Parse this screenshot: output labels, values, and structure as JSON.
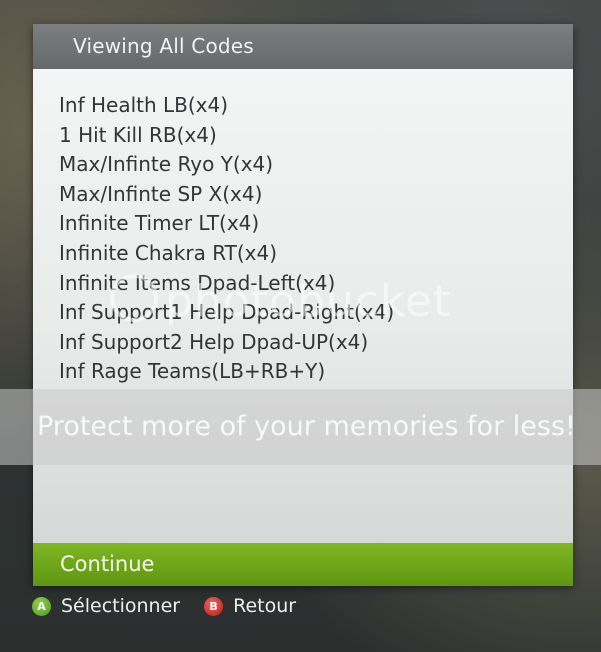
{
  "dialog": {
    "title": "Viewing All Codes",
    "codes": [
      "Inf Health LB(x4)",
      "1 Hit Kill RB(x4)",
      "Max/Infinte Ryo Y(x4)",
      "Max/Infinte SP X(x4)",
      "Infinite Timer LT(x4)",
      "Infinite Chakra RT(x4)",
      "Infinite Items Dpad-Left(x4)",
      "Inf Support1 Help Dpad-Right(x4)",
      "Inf Support2 Help Dpad-UP(x4)",
      "Inf Rage Teams(LB+RB+Y)"
    ],
    "continue_label": "Continue"
  },
  "footer": {
    "select": {
      "button_glyph": "A",
      "label": "Sélectionner"
    },
    "back": {
      "button_glyph": "B",
      "label": "Retour"
    }
  },
  "watermark": {
    "logo_text": "photobucket",
    "banner_text": "Protect more of your memories for less!"
  },
  "colors": {
    "header_bg": "#707374",
    "body_bg": "#eeefef",
    "continue_bg": "#6fa61a",
    "button_a": "#5fb022",
    "button_b": "#d0322a"
  }
}
